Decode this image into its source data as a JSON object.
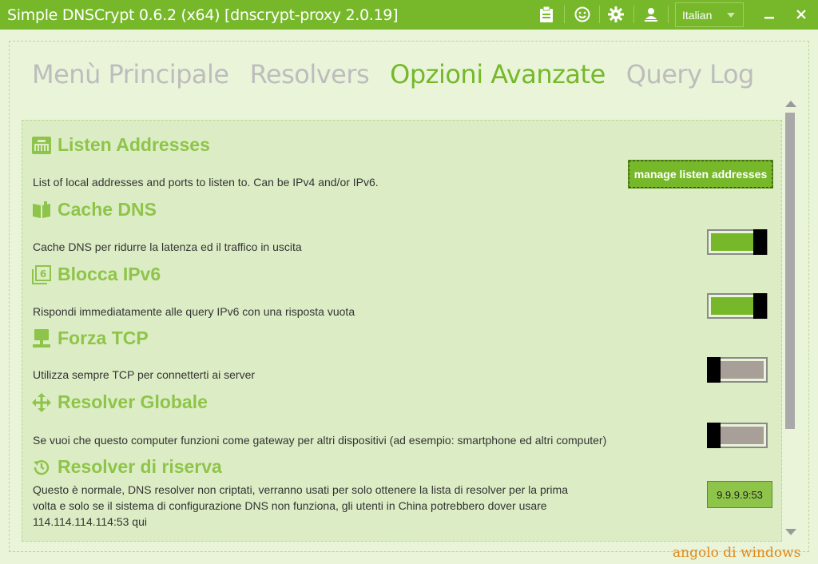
{
  "window": {
    "title": "Simple DNSCrypt 0.6.2 (x64) [dnscrypt-proxy 2.0.19]",
    "language": "Italian",
    "minimize_label": "‗",
    "close_label": "✕"
  },
  "tabs": [
    {
      "label": "Menù Principale",
      "active": false
    },
    {
      "label": "Resolvers",
      "active": false
    },
    {
      "label": "Opzioni Avanzate",
      "active": true
    },
    {
      "label": "Query Log",
      "active": false
    }
  ],
  "sections": {
    "listen": {
      "title": "Listen Addresses",
      "icon": "network-icon",
      "description": "List of local addresses and ports to listen to. Can be IPv4 and/or IPv6.",
      "button_label": "manage listen addresses"
    },
    "cache": {
      "title": "Cache DNS",
      "icon": "book-icon",
      "description": "Cache DNS per ridurre la latenza ed il traffico in uscita",
      "enabled": true
    },
    "ipv6": {
      "title": "Blocca IPv6",
      "icon": "ipv6-icon",
      "description": "Rispondi immediatamente alle query IPv6 con una risposta vuota",
      "enabled": true
    },
    "tcp": {
      "title": "Forza TCP",
      "icon": "monitor-icon",
      "description": "Utilizza sempre TCP per connetterti ai server",
      "enabled": false
    },
    "global": {
      "title": "Resolver Globale",
      "icon": "move-arrows-icon",
      "description": "Se vuoi che questo computer funzioni come gateway per altri dispositivi (ad esempio: smartphone ed altri computer)",
      "enabled": false
    },
    "fallback": {
      "title": "Resolver di riserva",
      "icon": "history-icon",
      "description": "Questo è normale, DNS resolver non criptati, verranno usati per solo ottenere la lista di resolver per la prima volta e solo se il sistema di configurazione DNS non funziona, gli utenti in China potrebbero dover usare 114.114.114.114:53 qui",
      "value": "9.9.9.9:53"
    }
  },
  "watermark": "angolo di windows",
  "colors": {
    "accent": "#76b82a",
    "section_title": "#8fc44a",
    "background": "#e9f4d9"
  }
}
